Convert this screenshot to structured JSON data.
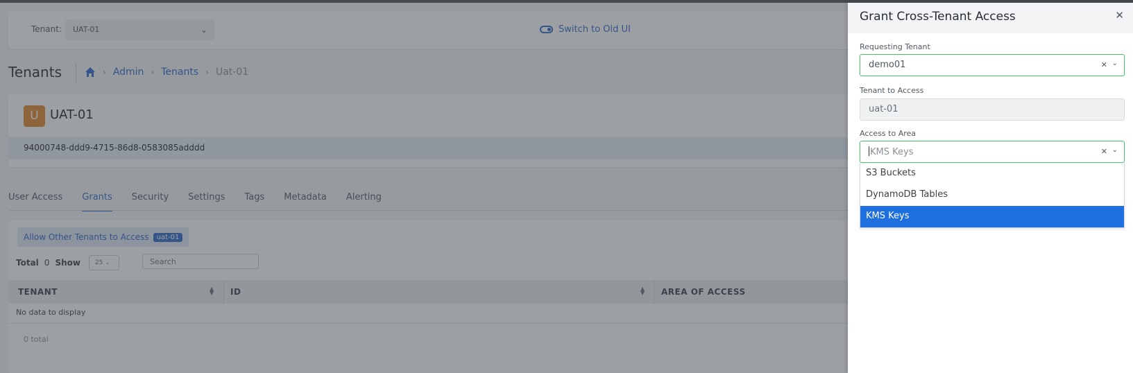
{
  "header": {
    "tenant_label": "Tenant:",
    "tenant_value": "UAT-01",
    "switch_link": "Switch to Old UI"
  },
  "page": {
    "title": "Tenants",
    "breadcrumb": [
      "Admin",
      "Tenants",
      "Uat-01"
    ]
  },
  "tenant_card": {
    "avatar_letter": "U",
    "name": "UAT-01",
    "id": "94000748-ddd9-4715-86d8-0583085adddd"
  },
  "tabs": [
    "User Access",
    "Grants",
    "Security",
    "Settings",
    "Tags",
    "Metadata",
    "Alerting"
  ],
  "grants": {
    "allow_button": "Allow Other Tenants to Access",
    "allow_badge": "uat-01",
    "total_label": "Total",
    "total_value": "0",
    "show_label": "Show",
    "page_size": "25",
    "search_placeholder": "Search",
    "columns": [
      "TENANT",
      "ID",
      "AREA OF ACCESS"
    ],
    "empty_text": "No data to display",
    "footer": "0 total"
  },
  "panel": {
    "title": "Grant Cross-Tenant Access",
    "requesting_label": "Requesting Tenant",
    "requesting_value": "demo01",
    "access_label": "Tenant to Access",
    "access_value": "uat-01",
    "area_label": "Access to Area",
    "area_value": "KMS Keys",
    "area_options": [
      "S3 Buckets",
      "DynamoDB Tables",
      "KMS Keys"
    ],
    "selected_option": "KMS Keys"
  },
  "colors": {
    "accent": "#2f66c7",
    "focus_border": "#44c26a",
    "selected_option_bg": "#1f6fe0",
    "avatar_bg": "#e0892e"
  }
}
